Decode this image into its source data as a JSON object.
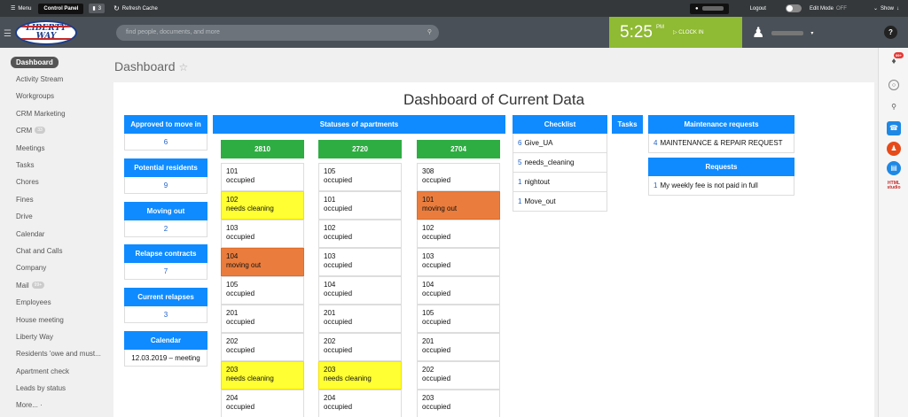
{
  "topbar": {
    "menu_label": "Menu",
    "control_panel_label": "Control Panel",
    "notifications_count": "3",
    "refresh_label": "Refresh Cache",
    "logout_label": "Logout",
    "edit_mode_label": "Edit Mode",
    "edit_mode_state": "OFF",
    "show_label": "Show"
  },
  "header": {
    "logo_text": "LIBERTY WAY",
    "search_placeholder": "find people, documents, and more",
    "clock_time": "5:25",
    "clock_ampm": "PM",
    "clock_in_label": "CLOCK IN",
    "help_label": "?"
  },
  "sidebar": {
    "items": [
      {
        "label": "Dashboard",
        "active": true
      },
      {
        "label": "Activity Stream"
      },
      {
        "label": "Workgroups"
      },
      {
        "label": "CRM Marketing"
      },
      {
        "label": "CRM",
        "count": "33"
      },
      {
        "label": "Meetings"
      },
      {
        "label": "Tasks"
      },
      {
        "label": "Chores"
      },
      {
        "label": "Fines"
      },
      {
        "label": "Drive"
      },
      {
        "label": "Calendar"
      },
      {
        "label": "Chat and Calls"
      },
      {
        "label": "Company"
      },
      {
        "label": "Mail",
        "count": "99+"
      },
      {
        "label": "Employees"
      },
      {
        "label": "House meeting"
      },
      {
        "label": "Liberty Way"
      },
      {
        "label": "Residents 'owe and must..."
      },
      {
        "label": "Apartment check"
      },
      {
        "label": "Leads by status"
      },
      {
        "label": "More... ·"
      }
    ]
  },
  "rightbar": {
    "notif_badge": "99+",
    "studio_label": "HTML studio"
  },
  "page": {
    "title": "Dashboard",
    "dashboard_title": "Dashboard of Current Data"
  },
  "stats": [
    {
      "label": "Approved to move in",
      "value": "6"
    },
    {
      "label": "Potential residents",
      "value": "9"
    },
    {
      "label": "Moving out",
      "value": "2"
    },
    {
      "label": "Relapse contracts",
      "value": "7"
    },
    {
      "label": "Current relapses",
      "value": "3"
    },
    {
      "label": "Calendar",
      "value": "12.03.2019 – meeting"
    }
  ],
  "statuses": {
    "label": "Statuses of apartments",
    "buildings": [
      {
        "name": "2810",
        "units": [
          {
            "num": "101",
            "status": "occupied",
            "color": "white"
          },
          {
            "num": "102",
            "status": "needs cleaning",
            "color": "yellow"
          },
          {
            "num": "103",
            "status": "occupied",
            "color": "white"
          },
          {
            "num": "104",
            "status": "moving out",
            "color": "orange"
          },
          {
            "num": "105",
            "status": "occupied",
            "color": "white"
          },
          {
            "num": "201",
            "status": "occupied",
            "color": "white"
          },
          {
            "num": "202",
            "status": "occupied",
            "color": "white"
          },
          {
            "num": "203",
            "status": "needs cleaning",
            "color": "yellow"
          },
          {
            "num": "204",
            "status": "occupied",
            "color": "white"
          }
        ]
      },
      {
        "name": "2720",
        "units": [
          {
            "num": "105",
            "status": "occupied",
            "color": "white"
          },
          {
            "num": "101",
            "status": "occupied",
            "color": "white"
          },
          {
            "num": "102",
            "status": "occupied",
            "color": "white"
          },
          {
            "num": "103",
            "status": "occupied",
            "color": "white"
          },
          {
            "num": "104",
            "status": "occupied",
            "color": "white"
          },
          {
            "num": "201",
            "status": "occupied",
            "color": "white"
          },
          {
            "num": "202",
            "status": "occupied",
            "color": "white"
          },
          {
            "num": "203",
            "status": "needs cleaning",
            "color": "yellow"
          },
          {
            "num": "204",
            "status": "occupied",
            "color": "white"
          }
        ]
      },
      {
        "name": "2704",
        "units": [
          {
            "num": "308",
            "status": "occupied",
            "color": "white"
          },
          {
            "num": "101",
            "status": "moving out",
            "color": "orange"
          },
          {
            "num": "102",
            "status": "occupied",
            "color": "white"
          },
          {
            "num": "103",
            "status": "occupied",
            "color": "white"
          },
          {
            "num": "104",
            "status": "occupied",
            "color": "white"
          },
          {
            "num": "105",
            "status": "occupied",
            "color": "white"
          },
          {
            "num": "201",
            "status": "occupied",
            "color": "white"
          },
          {
            "num": "202",
            "status": "occupied",
            "color": "white"
          },
          {
            "num": "203",
            "status": "occupied",
            "color": "white"
          }
        ]
      }
    ]
  },
  "checklist": {
    "label": "Checklist",
    "items": [
      {
        "count": "6",
        "name": "Give_UA"
      },
      {
        "count": "5",
        "name": "needs_cleaning"
      },
      {
        "count": "1",
        "name": "nightout"
      },
      {
        "count": "1",
        "name": "Move_out"
      }
    ]
  },
  "tasks": {
    "label": "Tasks"
  },
  "maintenance": {
    "label": "Maintenance requests",
    "items": [
      {
        "count": "4",
        "name": "MAINTENANCE & REPAIR REQUEST"
      }
    ]
  },
  "requests": {
    "label": "Requests",
    "items": [
      {
        "count": "1",
        "name": "My weekly fee is not paid in full"
      }
    ]
  },
  "colors": {
    "blue": "#0f8bff",
    "green": "#2ead43",
    "yellow": "#ffff33",
    "orange": "#ea7d3d",
    "clock_green": "#8fba33"
  }
}
